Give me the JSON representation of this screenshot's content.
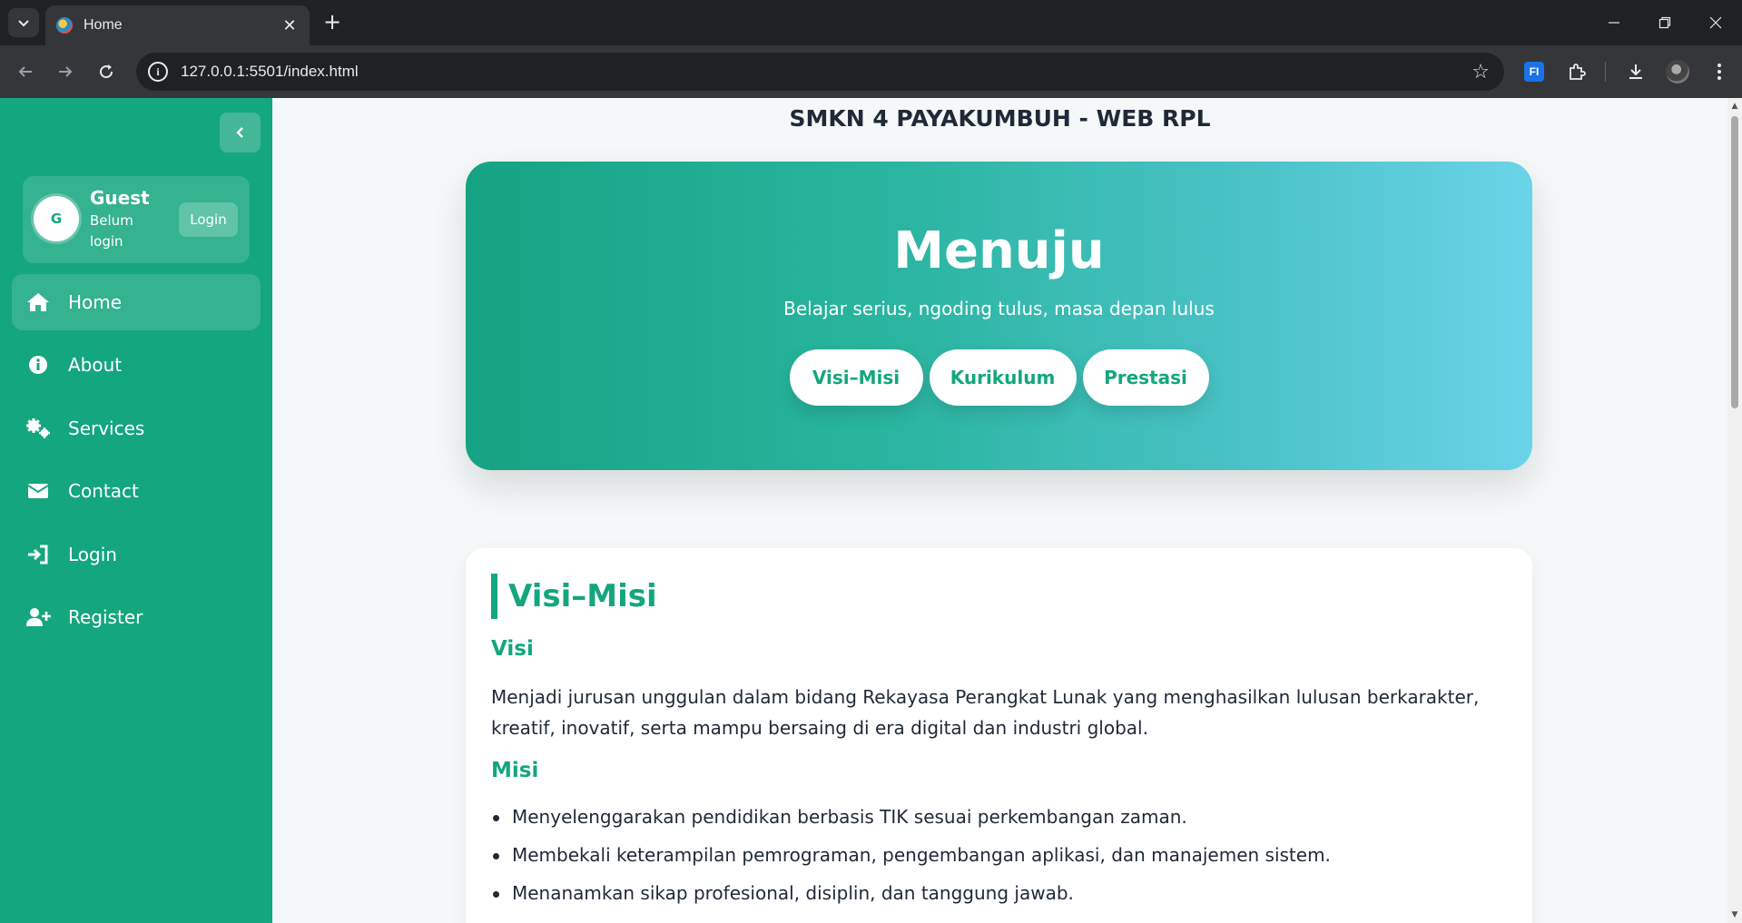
{
  "browser": {
    "tab_title": "Home",
    "url": "127.0.0.1:5501/index.html",
    "extension_label": "FI"
  },
  "sidebar": {
    "user": {
      "initial": "G",
      "name": "Guest",
      "status": "Belum login",
      "login_label": "Login"
    },
    "items": [
      {
        "label": "Home",
        "icon": "home-icon",
        "active": true
      },
      {
        "label": "About",
        "icon": "info-icon",
        "active": false
      },
      {
        "label": "Services",
        "icon": "gears-icon",
        "active": false
      },
      {
        "label": "Contact",
        "icon": "envelope-icon",
        "active": false
      },
      {
        "label": "Login",
        "icon": "sign-in-icon",
        "active": false
      },
      {
        "label": "Register",
        "icon": "user-plus-icon",
        "active": false
      }
    ]
  },
  "main": {
    "site_title": "SMKN 4 PAYAKUMBUH - WEB RPL",
    "hero": {
      "title": "Menuju",
      "subtitle": "Belajar serius, ngoding tulus, masa depan lulus",
      "buttons": [
        "Visi–Misi",
        "Kurikulum",
        "Prestasi"
      ]
    },
    "visi_misi": {
      "title": "Visi–Misi",
      "visi_heading": "Visi",
      "visi_text": "Menjadi jurusan unggulan dalam bidang Rekayasa Perangkat Lunak yang menghasilkan lulusan berkarakter, kreatif, inovatif, serta mampu bersaing di era digital dan industri global.",
      "misi_heading": "Misi",
      "misi_items": [
        "Menyelenggarakan pendidikan berbasis TIK sesuai perkembangan zaman.",
        "Membekali keterampilan pemrograman, pengembangan aplikasi, dan manajemen sistem.",
        "Menanamkan sikap profesional, disiplin, dan tanggung jawab."
      ]
    }
  },
  "colors": {
    "sidebar": "#14a67e",
    "accent": "#14a67e",
    "hero_start": "#16a383",
    "hero_end": "#6ad4e8",
    "text_dark": "#1f2937"
  }
}
